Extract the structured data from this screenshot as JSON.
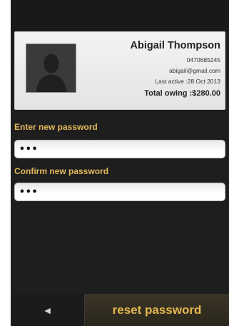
{
  "profile": {
    "name": "Abigail Thompson",
    "phone": "0470685245",
    "email": "abigail@gmail.com",
    "last_active": "Last active :28 Oct 2013",
    "total_owing": "Total owing :$280.00"
  },
  "form": {
    "new_password_label": "Enter new password",
    "new_password_value": "•••",
    "confirm_password_label": "Confirm new password",
    "confirm_password_value": "•••"
  },
  "footer": {
    "back_icon": "◄",
    "reset_label": "reset password"
  },
  "icons": {
    "avatar": "person-silhouette-icon",
    "back": "back-arrow-icon"
  },
  "colors": {
    "accent": "#e3b95b",
    "background": "#1e1e1e"
  }
}
